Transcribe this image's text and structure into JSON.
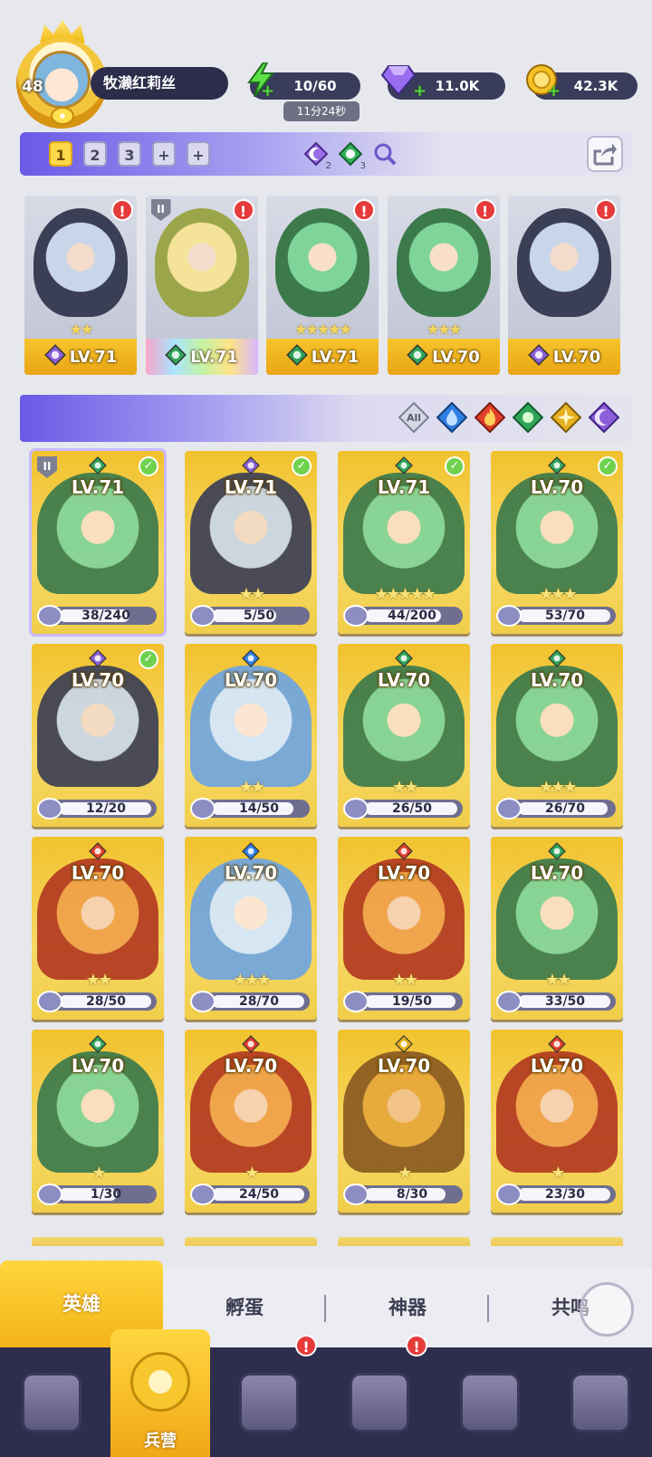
{
  "player": {
    "level": "48",
    "name": "牧濑红莉丝"
  },
  "resources": {
    "energy": {
      "value": "10/60",
      "timer": "11分24秒",
      "icon": "lightning-icon"
    },
    "gems": {
      "value": "11.0K",
      "icon": "diamond-icon"
    },
    "coins": {
      "value": "42.3K",
      "icon": "coin-icon"
    }
  },
  "team_tabs": [
    "1",
    "2",
    "3",
    "+",
    "+"
  ],
  "team_gem_counts": {
    "dark": "2",
    "nature": "3"
  },
  "team_slots": [
    {
      "level": "LV.71",
      "stars": "★★",
      "element": "dark",
      "alert": "!"
    },
    {
      "level": "LV.71",
      "stars": "",
      "element": "rainbow",
      "alert": "!",
      "shield": "II"
    },
    {
      "level": "LV.71",
      "stars": "★★★★★",
      "element": "nature",
      "alert": "!"
    },
    {
      "level": "LV.70",
      "stars": "★★★",
      "element": "nature",
      "alert": "!"
    },
    {
      "level": "LV.70",
      "stars": "",
      "element": "dark",
      "alert": "!"
    }
  ],
  "filter": {
    "all_label": "All",
    "elements": [
      "water-icon",
      "fire-icon",
      "nature-icon",
      "light-icon",
      "dark-icon"
    ]
  },
  "heroes": [
    {
      "level": "LV.71",
      "element": "nature",
      "fragments": "38/240",
      "fill": 0.16,
      "stars": "",
      "checked": true,
      "selected": true,
      "shield": "II"
    },
    {
      "level": "LV.71",
      "element": "dark",
      "fragments": "5/50",
      "fill": 0.1,
      "stars": "★★",
      "checked": true
    },
    {
      "level": "LV.71",
      "element": "nature",
      "fragments": "44/200",
      "fill": 0.22,
      "stars": "★★★★★",
      "checked": true
    },
    {
      "level": "LV.70",
      "element": "nature",
      "fragments": "53/70",
      "fill": 0.76,
      "stars": "★★★",
      "checked": true
    },
    {
      "level": "LV.70",
      "element": "dark",
      "fragments": "12/20",
      "fill": 0.6,
      "stars": "",
      "checked": true
    },
    {
      "level": "LV.70",
      "element": "water",
      "fragments": "14/50",
      "fill": 0.28,
      "stars": "★★"
    },
    {
      "level": "LV.70",
      "element": "nature",
      "fragments": "26/50",
      "fill": 0.52,
      "stars": "★★"
    },
    {
      "level": "LV.70",
      "element": "nature",
      "fragments": "26/70",
      "fill": 0.37,
      "stars": "★★★"
    },
    {
      "level": "LV.70",
      "element": "fire",
      "fragments": "28/50",
      "fill": 0.56,
      "stars": "★★"
    },
    {
      "level": "LV.70",
      "element": "water",
      "fragments": "28/70",
      "fill": 0.4,
      "stars": "★★★"
    },
    {
      "level": "LV.70",
      "element": "fire",
      "fragments": "19/50",
      "fill": 0.38,
      "stars": "★★"
    },
    {
      "level": "LV.70",
      "element": "nature",
      "fragments": "33/50",
      "fill": 0.66,
      "stars": "★★"
    },
    {
      "level": "LV.70",
      "element": "nature",
      "fragments": "1/30",
      "fill": 0.03,
      "stars": "★"
    },
    {
      "level": "LV.70",
      "element": "fire",
      "fragments": "24/50",
      "fill": 0.48,
      "stars": "★"
    },
    {
      "level": "LV.70",
      "element": "light",
      "fragments": "8/30",
      "fill": 0.27,
      "stars": "★"
    },
    {
      "level": "LV.70",
      "element": "fire",
      "fragments": "23/30",
      "fill": 0.77,
      "stars": "★"
    }
  ],
  "subtabs": [
    "英雄",
    "孵蛋",
    "神器",
    "共鸣"
  ],
  "nav": [
    {
      "icon": "cards-icon"
    },
    {
      "icon": "barracks-icon",
      "label": "兵营"
    },
    {
      "icon": "book-icon",
      "alert": "!"
    },
    {
      "icon": "castle-icon",
      "alert": "!"
    },
    {
      "icon": "mushroom-icon"
    },
    {
      "icon": "banner-icon"
    }
  ],
  "colors": {
    "dark": "#8c5fd8",
    "nature": "#2fa55a",
    "water": "#2f7fe0",
    "fire": "#e0402a",
    "light": "#e6b020",
    "rainbow": "#b06ee8",
    "accent": "#f3c22e",
    "nav_bg": "#2d2e4e"
  }
}
